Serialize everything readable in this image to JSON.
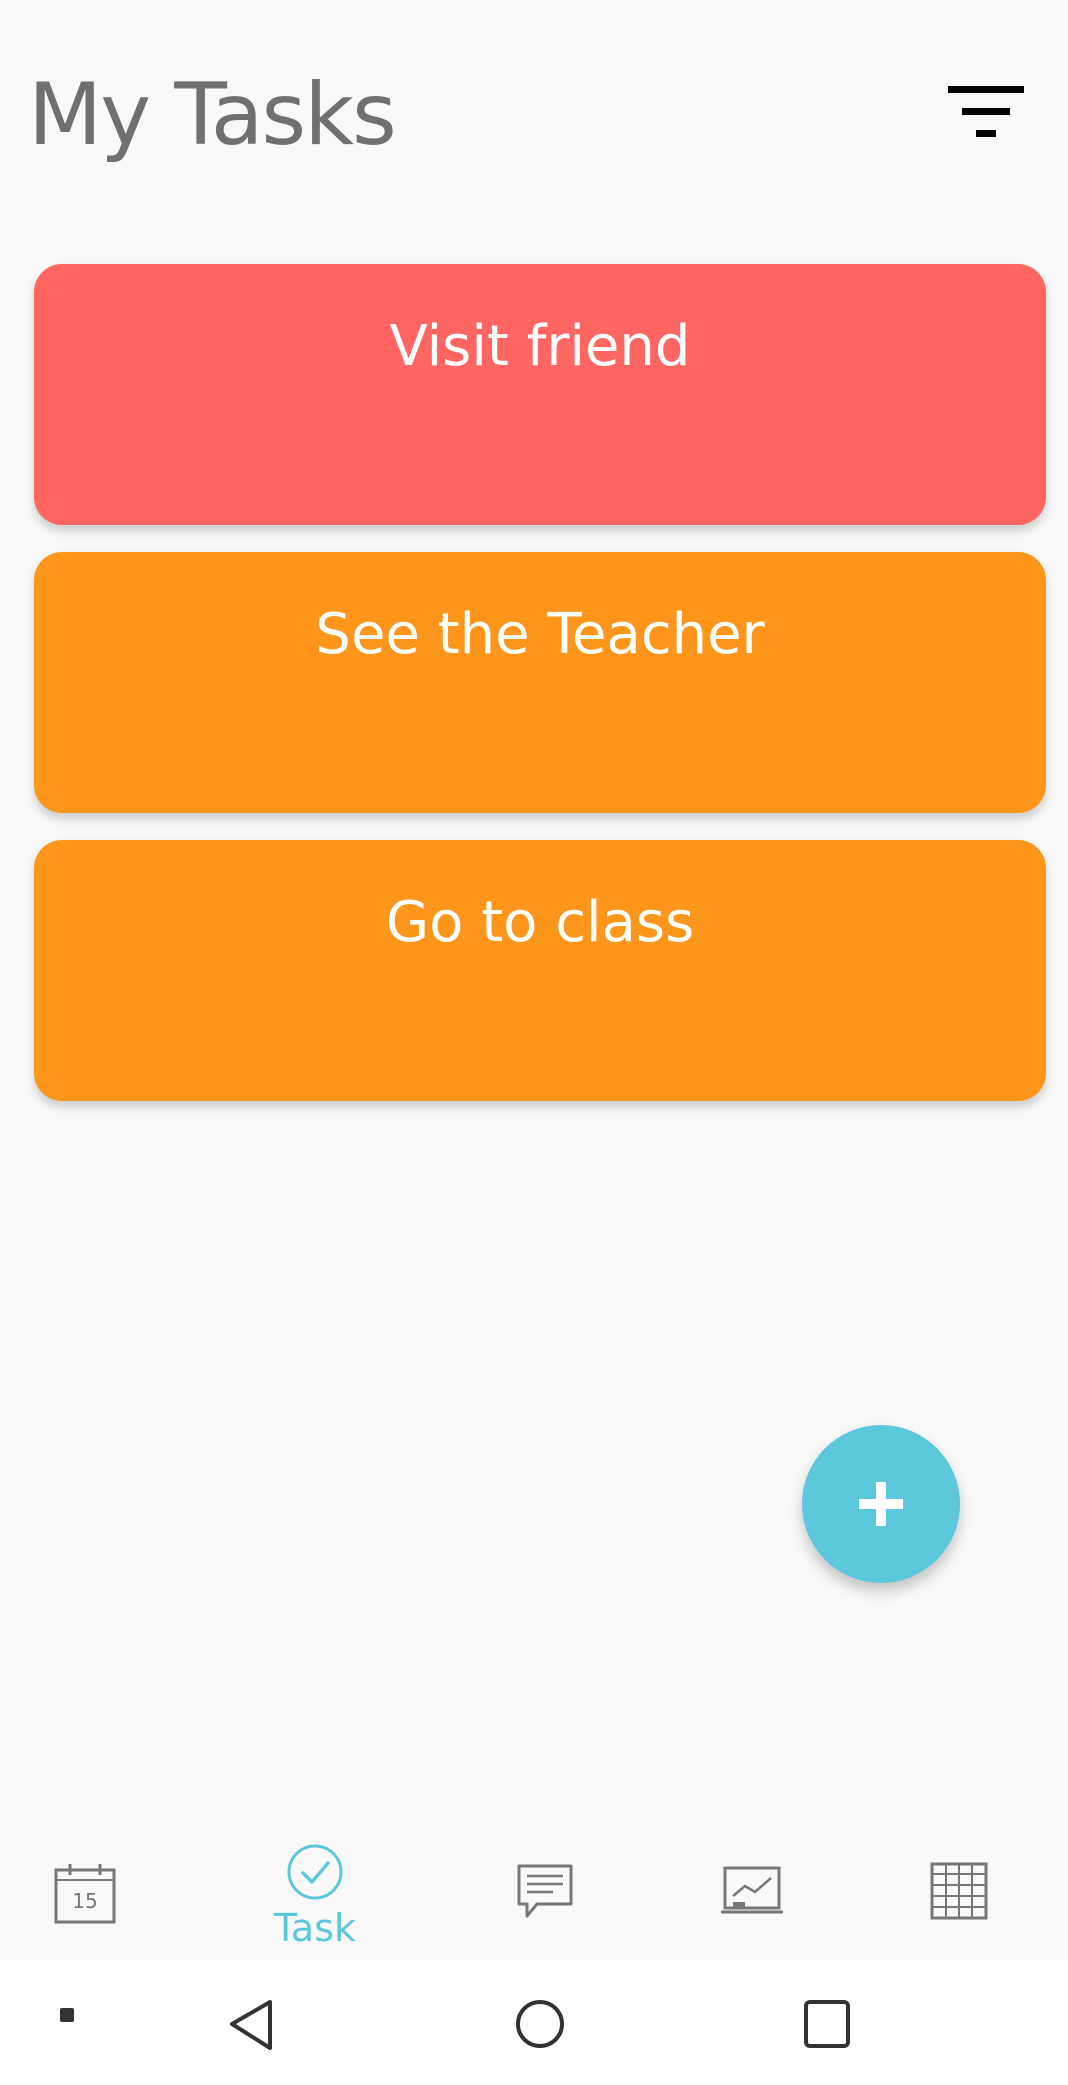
{
  "header": {
    "title": "My Tasks",
    "filter_icon": "filter-icon"
  },
  "tasks": [
    {
      "title": "Visit friend",
      "color": "#ff6661"
    },
    {
      "title": "See the Teacher",
      "color": "#ff961c"
    },
    {
      "title": "Go to class",
      "color": "#ff961c"
    }
  ],
  "fab": {
    "icon": "plus-icon",
    "color": "#5bc8dc"
  },
  "bottom_nav": {
    "active_color": "#5bc8dc",
    "inactive_color": "#777777",
    "items": [
      {
        "icon": "calendar-icon",
        "calendar_day": "15",
        "label": ""
      },
      {
        "icon": "check-circle-icon",
        "label": "Task",
        "active": true
      },
      {
        "icon": "message-icon",
        "label": ""
      },
      {
        "icon": "chart-board-icon",
        "label": ""
      },
      {
        "icon": "table-grid-icon",
        "label": ""
      }
    ]
  },
  "system_nav": {
    "items": [
      "recents-dot-icon",
      "back-icon",
      "home-icon",
      "overview-icon"
    ]
  }
}
